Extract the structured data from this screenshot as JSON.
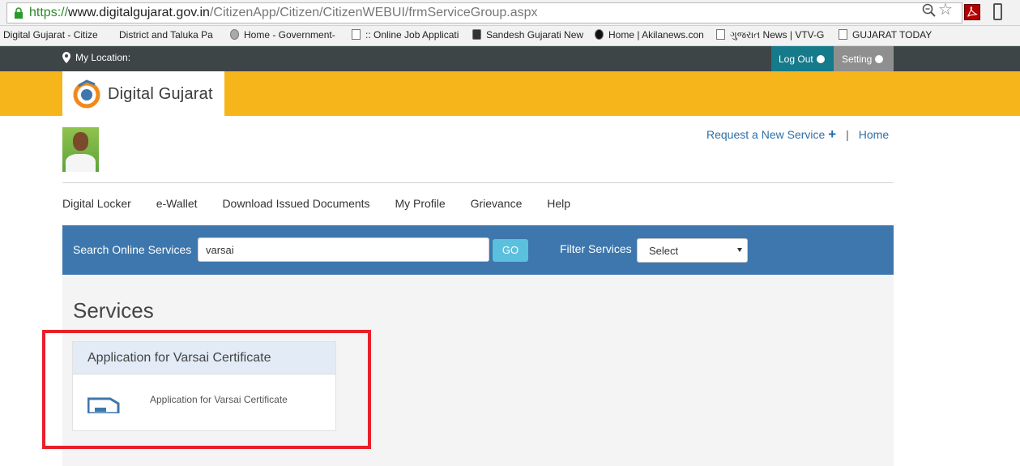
{
  "browser": {
    "url_scheme": "https://",
    "url_domain": "www.digitalgujarat.gov.in",
    "url_path": "/CitizenApp/Citizen/CitizenWEBUI/frmServiceGroup.aspx",
    "bookmarks": [
      {
        "label": "Digital Gujarat - Citize"
      },
      {
        "label": "District and Taluka Pa"
      },
      {
        "label": "Home - Government-"
      },
      {
        "label": ":: Online Job Applicati"
      },
      {
        "label": "Sandesh Gujarati New"
      },
      {
        "label": "Home | Akilanews.con"
      },
      {
        "label": "ગુજરાત News | VTV-G"
      },
      {
        "label": "GUJARAT TODAY"
      }
    ]
  },
  "topbar": {
    "location_label": "My Location:",
    "logout_label": "Log Out",
    "setting_label": "Setting"
  },
  "brand": {
    "name": "Digital Gujarat",
    "accent": "#f6b51a"
  },
  "header_links": {
    "request_label": "Request a New Service",
    "separator": "|",
    "home_label": "Home"
  },
  "nav": {
    "items": [
      "Digital Locker",
      "e-Wallet",
      "Download Issued Documents",
      "My Profile",
      "Grievance",
      "Help"
    ]
  },
  "search": {
    "label": "Search Online Services",
    "value": "varsai",
    "go_label": "GO",
    "filter_label": "Filter Services",
    "filter_selected": "Select"
  },
  "services": {
    "title": "Services",
    "cards": [
      {
        "title": "Application for Varsai Certificate",
        "description": "Application for Varsai Certificate"
      }
    ]
  },
  "colors": {
    "topbar": "#3d4547",
    "search_bar": "#3e77ad",
    "logout": "#157a8a",
    "highlight": "#e8202a"
  }
}
